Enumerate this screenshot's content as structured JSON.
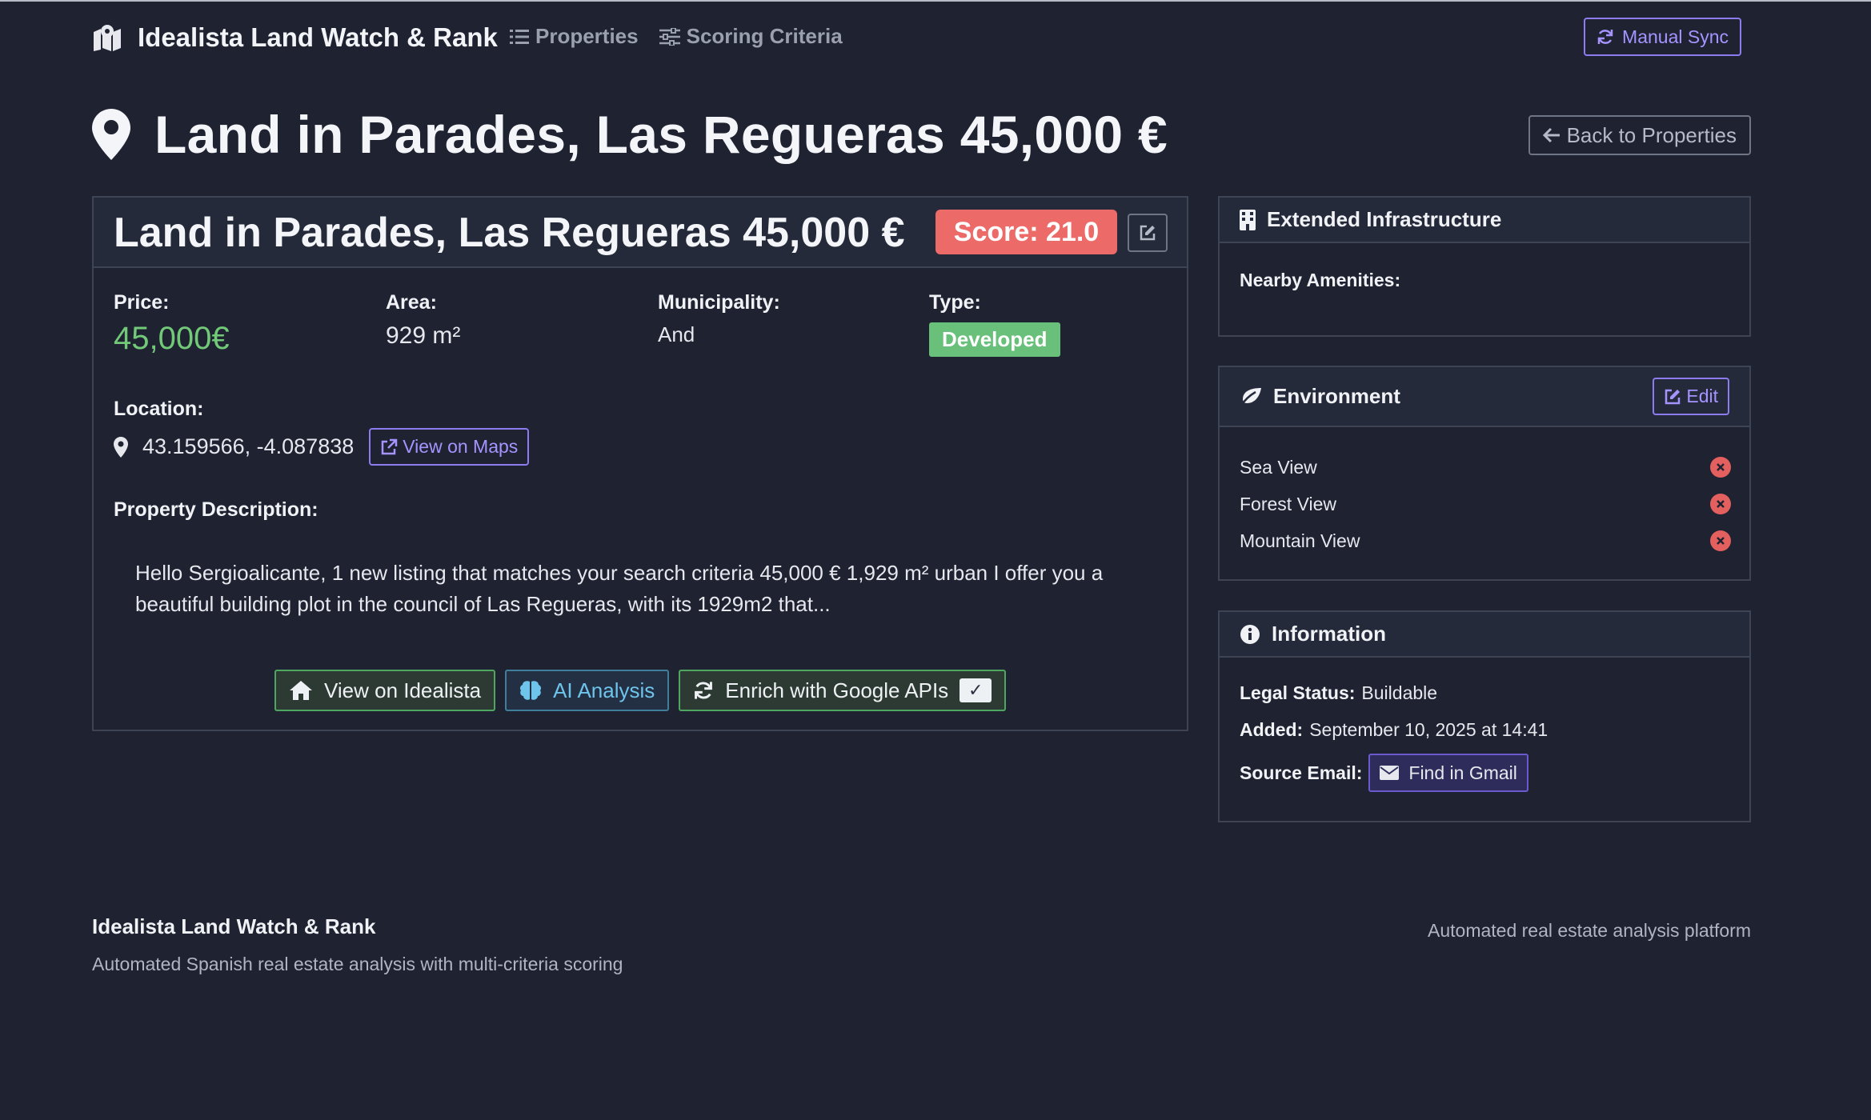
{
  "navbar": {
    "brand": "Idealista Land Watch & Rank",
    "links": [
      {
        "label": "Properties",
        "icon": "list-icon"
      },
      {
        "label": "Scoring Criteria",
        "icon": "sliders-icon"
      }
    ],
    "sync_label": "Manual Sync"
  },
  "page": {
    "title": "Land in Parades, Las Regueras 45,000 €",
    "back_label": "Back to Properties"
  },
  "property": {
    "title": "Land in Parades, Las Regueras 45,000 €",
    "score": "Score: 21.0",
    "price_label": "Price:",
    "price": "45,000€",
    "area_label": "Area:",
    "area": "929 m²",
    "municipality_label": "Municipality:",
    "municipality": "And",
    "type_label": "Type:",
    "type": "Developed",
    "location_label": "Location:",
    "coords": "43.159566, -4.087838",
    "maps_label": "View on Maps",
    "description_label": "Property Description:",
    "description": "Hello Sergioalicante, 1 new listing that matches your search criteria 45,000 € 1,929 m² urban I offer you a beautiful building plot in the council of Las Regueras, with its 1929m2 that...",
    "actions": {
      "idealista": "View on Idealista",
      "ai": "AI Analysis",
      "enrich": "Enrich with Google APIs",
      "enrich_check": "✓"
    }
  },
  "infrastructure": {
    "title": "Extended Infrastructure",
    "amenities_label": "Nearby Amenities:"
  },
  "environment": {
    "title": "Environment",
    "edit_label": "Edit",
    "items": [
      "Sea View",
      "Forest View",
      "Mountain View"
    ]
  },
  "information": {
    "title": "Information",
    "legal_label": "Legal Status:",
    "legal_value": "Buildable",
    "added_label": "Added:",
    "added_value": "September 10, 2025 at 14:41",
    "source_label": "Source Email:",
    "gmail_label": "Find in Gmail"
  },
  "footer": {
    "title": "Idealista Land Watch & Rank",
    "subtitle": "Automated Spanish real estate analysis with multi-criteria scoring",
    "right": "Automated real estate analysis platform"
  },
  "colors": {
    "background": "#1e2231",
    "accent": "#8c7cf0",
    "score": "#ec6b68",
    "price": "#72c978",
    "success": "#68c07a"
  }
}
